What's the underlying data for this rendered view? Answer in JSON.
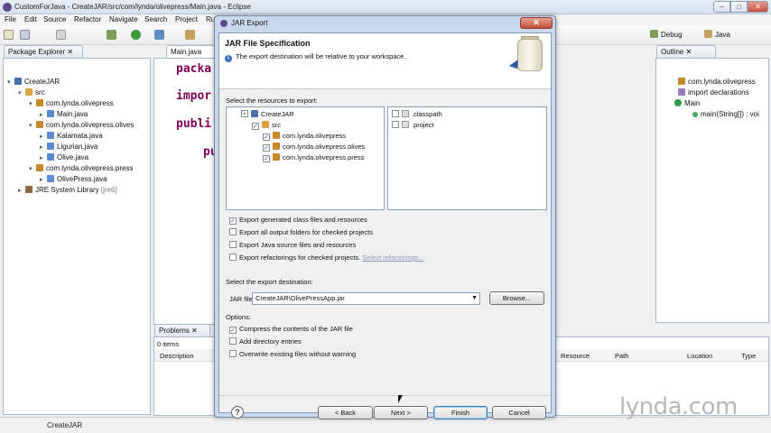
{
  "window": {
    "title": "CustomForJava - CreateJAR/src/com/lynda/olivepress/Main.java - Eclipse"
  },
  "menu": [
    "File",
    "Edit",
    "Source",
    "Refactor",
    "Navigate",
    "Search",
    "Project",
    "Ru"
  ],
  "perspectives": [
    "Debug",
    "Java"
  ],
  "package_explorer": {
    "tab": "Package Explorer",
    "tree": [
      {
        "label": "CreateJAR",
        "icon": "project-icon"
      },
      {
        "label": "src",
        "icon": "source-folder-icon"
      },
      {
        "label": "com.lynda.olivepress",
        "icon": "package-icon"
      },
      {
        "label": "Main.java",
        "icon": "java-file-icon"
      },
      {
        "label": "com.lynda.olivepress.olives",
        "icon": "package-icon"
      },
      {
        "label": "Kalamata.java",
        "icon": "java-file-icon"
      },
      {
        "label": "Ligurian.java",
        "icon": "java-file-icon"
      },
      {
        "label": "Olive.java",
        "icon": "java-file-icon"
      },
      {
        "label": "com.lynda.olivepress.press",
        "icon": "package-icon"
      },
      {
        "label": "OlivePress.java",
        "icon": "java-file-icon"
      },
      {
        "label": "JRE System Library",
        "suffix": "[jre6]",
        "icon": "library-icon"
      }
    ]
  },
  "editor": {
    "tab": "Main.java",
    "lines": [
      "packa",
      "impor",
      "publi",
      "pu"
    ]
  },
  "outline": {
    "tab": "Outline",
    "items": [
      "com.lynda.olivepress",
      "import declarations",
      "Main",
      "main(String[]) : voi"
    ]
  },
  "problems": {
    "tab": "Problems",
    "count": "0 items",
    "columns": [
      "Description",
      "Resource",
      "Path",
      "Location",
      "Type"
    ]
  },
  "status_bar": {
    "text": "CreateJAR"
  },
  "dialog": {
    "title": "JAR Export",
    "header_title": "JAR File Specification",
    "header_info": "The export destination will be relative to your workspace.",
    "resources_label": "Select the resources to export:",
    "resource_tree": [
      {
        "label": "CreateJAR",
        "state": "partial"
      },
      {
        "label": "src",
        "state": "checked"
      },
      {
        "label": "com.lynda.olivepress",
        "state": "checked"
      },
      {
        "label": "com.lynda.olivepress.olives",
        "state": "checked"
      },
      {
        "label": "com.lynda.olivepress.press",
        "state": "checked"
      }
    ],
    "resource_files": [
      {
        "label": ".classpath",
        "state": "unchecked"
      },
      {
        "label": ".project",
        "state": "unchecked"
      }
    ],
    "export_options": [
      {
        "label": "Export generated class files and resources",
        "checked": true
      },
      {
        "label": "Export all output folders for checked projects",
        "checked": false
      },
      {
        "label": "Export Java source files and resources",
        "checked": false
      },
      {
        "label": "Export refactorings for checked projects.",
        "checked": false
      }
    ],
    "select_refactorings_link": "Select refactorings...",
    "destination_label": "Select the export destination:",
    "jar_file_label": "JAR file:",
    "jar_file_value": "CreateJAR\\OlivePressApp.jar",
    "browse_label": "Browse...",
    "options_label": "Options:",
    "options": [
      {
        "label": "Compress the contents of the JAR file",
        "checked": true
      },
      {
        "label": "Add directory entries",
        "checked": false
      },
      {
        "label": "Overwrite existing files without warning",
        "checked": false
      }
    ],
    "buttons": {
      "help": "?",
      "back": "< Back",
      "next": "Next >",
      "finish": "Finish",
      "cancel": "Cancel"
    }
  },
  "watermark": "lynda.com"
}
